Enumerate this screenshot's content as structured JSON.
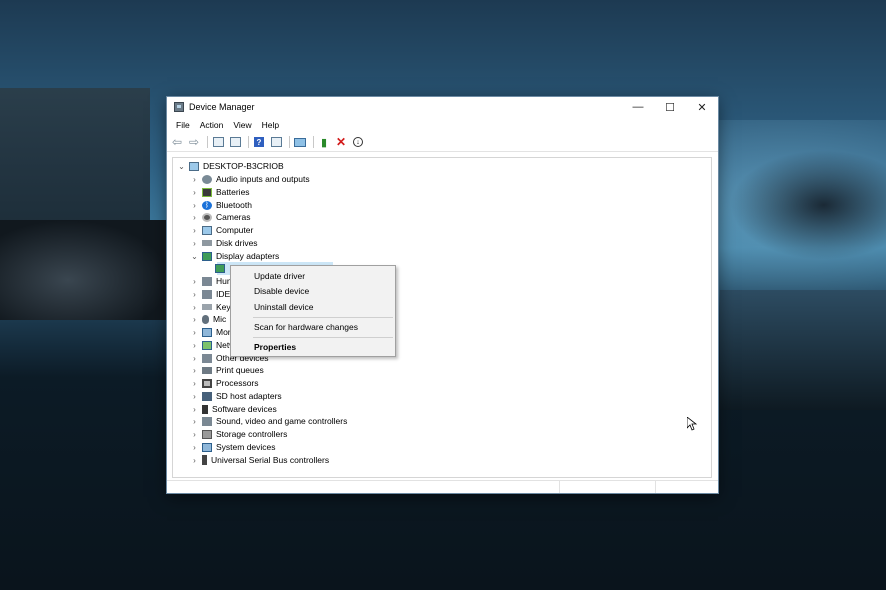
{
  "window": {
    "title": "Device Manager",
    "controls": {
      "minimize": "—",
      "maximize": "☐",
      "close": "✕"
    }
  },
  "menubar": {
    "items": [
      "File",
      "Action",
      "View",
      "Help"
    ]
  },
  "toolbar": {
    "icons": [
      "back-arrow-icon",
      "forward-arrow-icon",
      "show-hide-console-tree-icon",
      "properties-icon",
      "help-icon",
      "view-icon",
      "scan-monitor-icon",
      "update-driver-icon",
      "uninstall-x-icon",
      "disable-download-icon"
    ]
  },
  "tree": {
    "root": "DESKTOP-B3CRIOB",
    "categories": [
      {
        "label": "Audio inputs and outputs",
        "icon": "audio-icon"
      },
      {
        "label": "Batteries",
        "icon": "battery-icon"
      },
      {
        "label": "Bluetooth",
        "icon": "bluetooth-icon"
      },
      {
        "label": "Cameras",
        "icon": "camera-icon"
      },
      {
        "label": "Computer",
        "icon": "computer-icon"
      },
      {
        "label": "Disk drives",
        "icon": "disk-icon"
      },
      {
        "label": "Display adapters",
        "icon": "display-icon",
        "expanded": true
      },
      {
        "label": "",
        "icon": "display-device-icon",
        "child": true,
        "selected": true
      },
      {
        "label": "Hun",
        "icon": "hid-icon"
      },
      {
        "label": "IDE",
        "icon": "ide-icon"
      },
      {
        "label": "Key",
        "icon": "keyboard-icon"
      },
      {
        "label": "Mic",
        "icon": "mouse-icon"
      },
      {
        "label": "Mon",
        "icon": "monitor-icon"
      },
      {
        "label": "Netw",
        "icon": "network-icon"
      },
      {
        "label": "Other devices",
        "icon": "other-devices-icon"
      },
      {
        "label": "Print queues",
        "icon": "printer-icon"
      },
      {
        "label": "Processors",
        "icon": "processor-icon"
      },
      {
        "label": "SD host adapters",
        "icon": "sd-icon"
      },
      {
        "label": "Software devices",
        "icon": "software-icon"
      },
      {
        "label": "Sound, video and game controllers",
        "icon": "sound-icon"
      },
      {
        "label": "Storage controllers",
        "icon": "storage-icon"
      },
      {
        "label": "System devices",
        "icon": "system-icon"
      },
      {
        "label": "Universal Serial Bus controllers",
        "icon": "usb-icon"
      }
    ]
  },
  "context_menu": {
    "items": [
      "Update driver",
      "Disable device",
      "Uninstall device",
      "Scan for hardware changes",
      "Properties"
    ]
  },
  "colors": {
    "selection": "#cce6f7",
    "accent": "#1b72d9",
    "delete": "#d21a1a"
  }
}
